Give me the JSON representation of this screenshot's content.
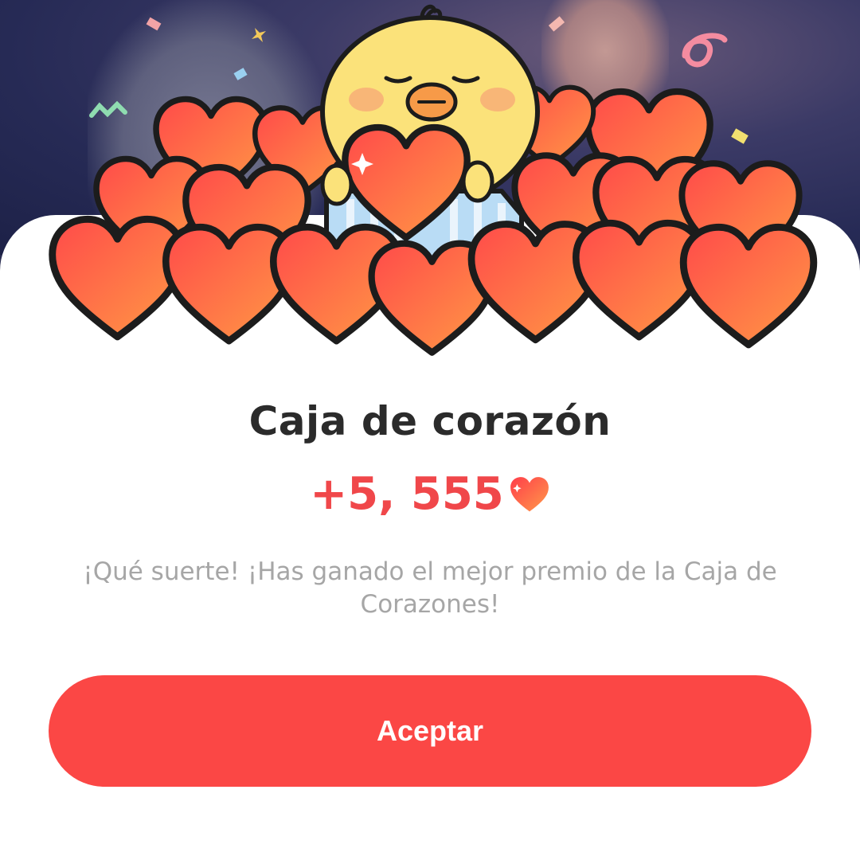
{
  "dialog": {
    "title": "Caja de corazón",
    "reward_amount": "+5, 555",
    "reward_icon": "heart-icon",
    "message": "¡Qué suerte!  ¡Has ganado el mejor premio de la Caja de Corazones!",
    "accept_label": "Aceptar"
  },
  "colors": {
    "accent": "#fb4745",
    "reward_text": "#f0474a",
    "title_text": "#2b2b2b",
    "message_text": "#a6a6a6",
    "heart_fill": "#f85a3c",
    "chick_yellow": "#fbe27a"
  }
}
